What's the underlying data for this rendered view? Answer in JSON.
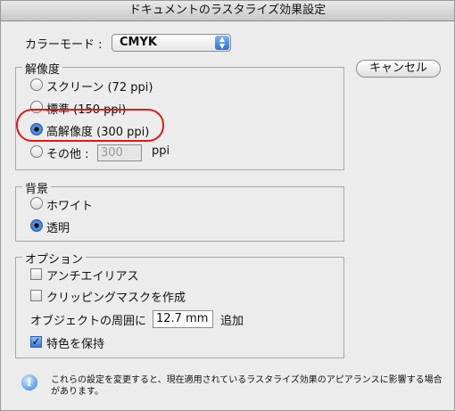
{
  "window": {
    "title": "ドキュメントのラスタライズ効果設定"
  },
  "color_mode": {
    "label": "カラーモード :",
    "value": "CMYK"
  },
  "resolution": {
    "title": "解像度",
    "options": [
      {
        "label": "スクリーン (72 ppi)",
        "selected": false
      },
      {
        "label": "標準 (150 ppi)",
        "selected": false
      },
      {
        "label": "高解像度 (300 ppi)",
        "selected": true
      },
      {
        "label": "その他 :",
        "selected": false
      }
    ],
    "other_value": "300",
    "other_unit": "ppi"
  },
  "background": {
    "title": "背景",
    "options": [
      {
        "label": "ホワイト",
        "selected": false
      },
      {
        "label": "透明",
        "selected": true
      }
    ]
  },
  "options": {
    "title": "オプション",
    "antialias_label": "アンチエイリアス",
    "antialias_checked": false,
    "clipping_label": "クリッピングマスクを作成",
    "clipping_checked": false,
    "padding_label": "オブジェクトの周囲に",
    "padding_value": "12.7 mm",
    "padding_suffix": "追加",
    "spot_label": "特色を保持",
    "spot_checked": true
  },
  "buttons": {
    "cancel": "キャンセル"
  },
  "info": {
    "text": "これらの設定を変更すると、現在適用されているラスタライズ効果のアピアランスに影響する場合があります。"
  },
  "colors": {
    "highlight": "#e01818",
    "accent": "#2e6fd0"
  },
  "icons": {
    "select_arrows": "updown-arrows-icon",
    "info": "info-icon",
    "checkmark": "checkmark-icon"
  }
}
